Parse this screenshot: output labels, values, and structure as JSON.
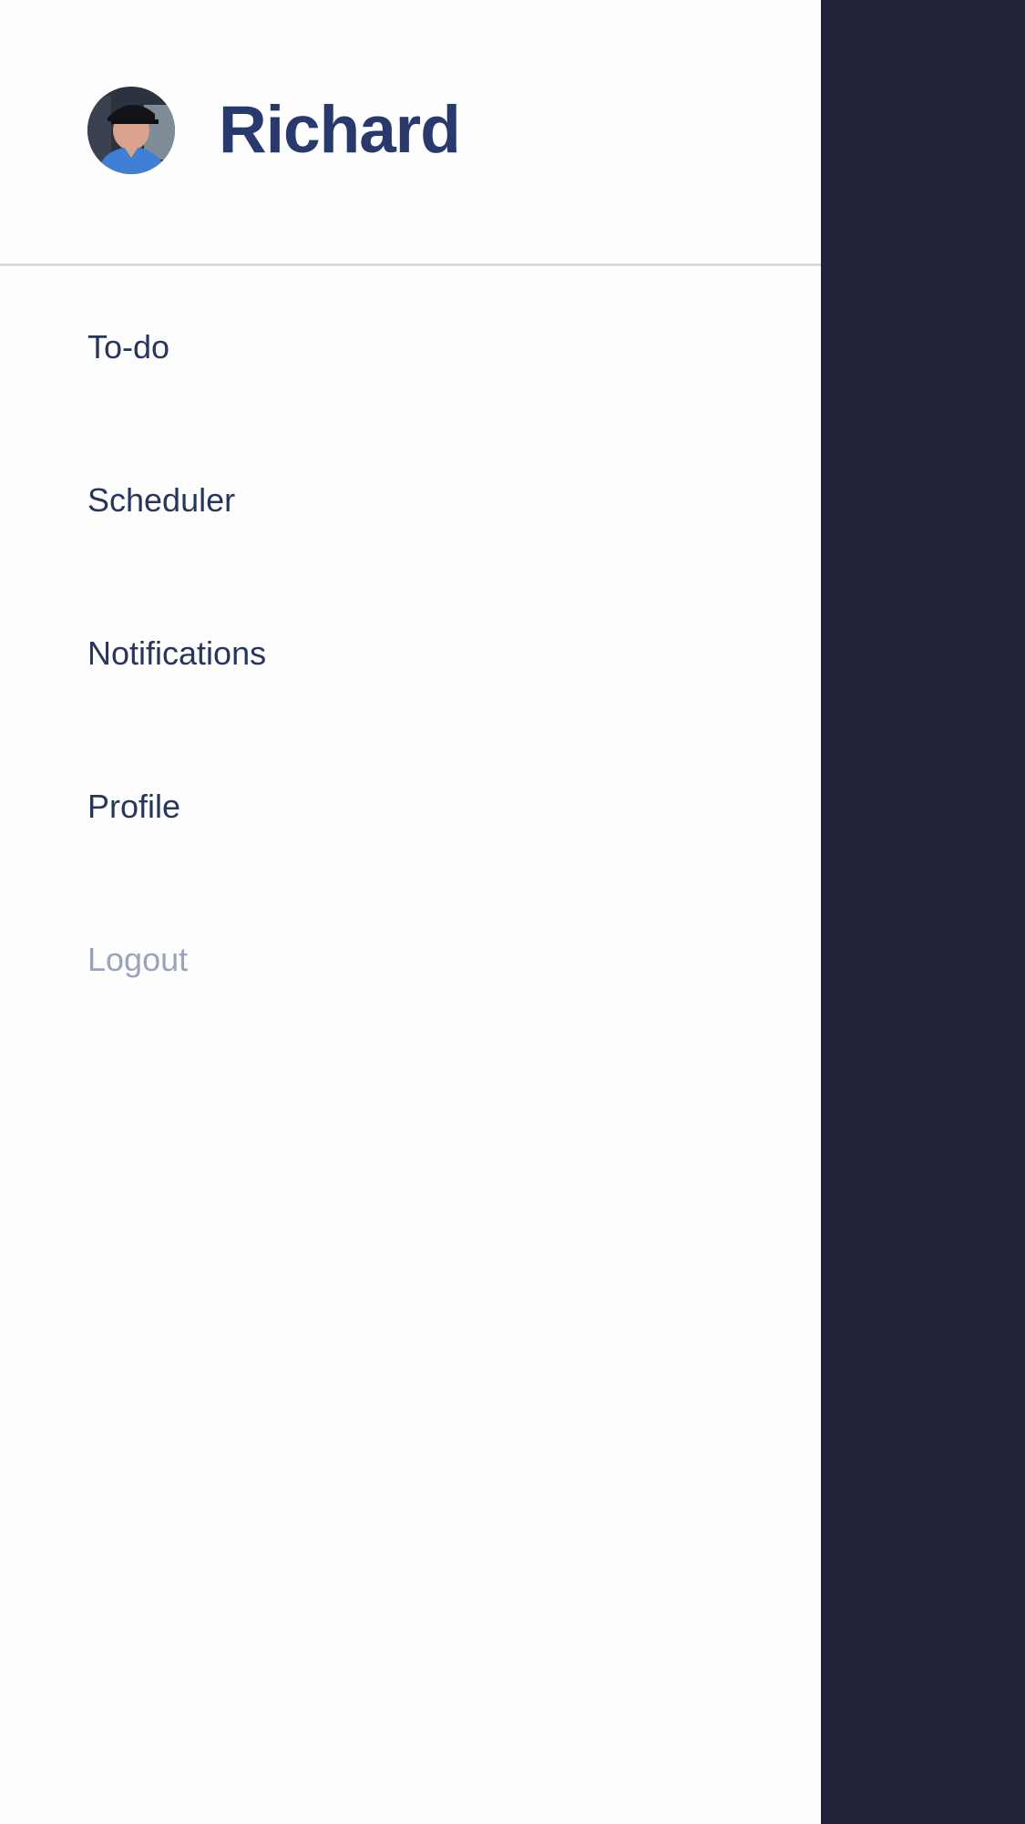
{
  "user": {
    "name": "Richard",
    "avatar_icon": "user-photo-avatar"
  },
  "menu": {
    "items": [
      {
        "label": "To-do"
      },
      {
        "label": "Scheduler"
      },
      {
        "label": "Notifications"
      },
      {
        "label": "Profile"
      },
      {
        "label": "Logout"
      }
    ]
  },
  "colors": {
    "drawer_background": "#fefefe",
    "overlay_background": "#22223b",
    "name_text": "#28396e",
    "menu_text": "#26365f",
    "logout_text": "#98a4bd",
    "divider": "#d6dde1"
  }
}
